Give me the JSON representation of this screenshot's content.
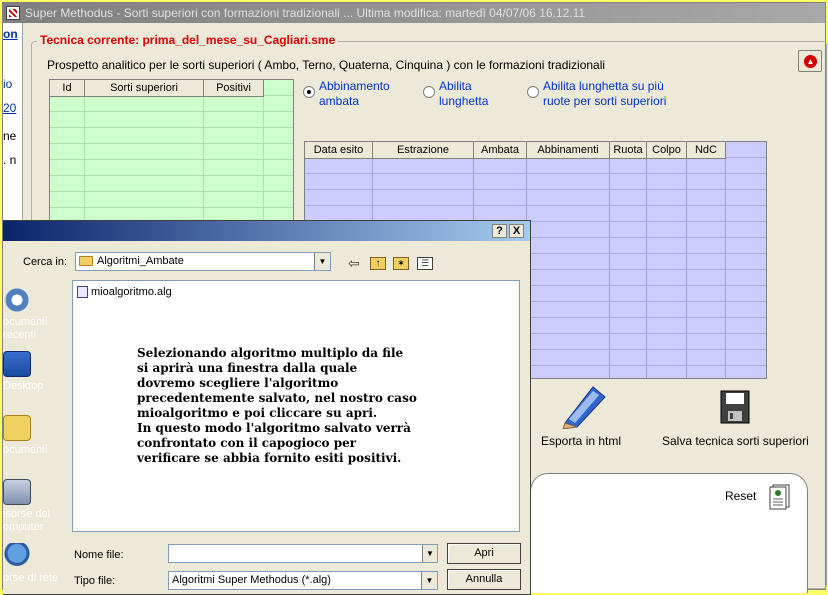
{
  "window": {
    "title": "Super Methodus - Sorti superiori con formazioni tradizionali ... Ultima modifica: martedì 04/07/06 16.12.11"
  },
  "left_strip": [
    "on",
    "io",
    "20",
    "ne",
    ". n"
  ],
  "technique": {
    "label": "Tecnica corrente: prima_del_mese_su_Cagliari.sme",
    "subtitle": "Prospetto analitico per le sorti superiori ( Ambo, Terno, Quaterna, Cinquina ) con le formazioni tradizionali"
  },
  "left_grid": {
    "columns": [
      "Id",
      "Sorti superiori",
      "Positivi"
    ]
  },
  "options": [
    {
      "label": "Abbinamento\nambata",
      "checked": true
    },
    {
      "label": "Abilita\nlunghetta",
      "checked": false
    },
    {
      "label": "Abilita lunghetta su più\nruote per sorti superiori",
      "checked": false
    }
  ],
  "results_grid": {
    "columns": [
      "Data esito",
      "Estrazione",
      "Ambata",
      "Abbinamenti",
      "Ruota",
      "Colpo",
      "NdC"
    ]
  },
  "tools": {
    "export_label": "Esporta in html",
    "save_label": "Salva tecnica sorti superiori",
    "reset_label": "Reset"
  },
  "dialog": {
    "help_btn": "?",
    "close_btn": "X",
    "look_in_label": "Cerca in:",
    "look_in_value": "Algoritmi_Ambate",
    "places": [
      "ocumenti\nrecenti",
      "Desktop",
      "ocumenti",
      "isorse del\nomputer",
      "orse di rete"
    ],
    "files": [
      "mioalgoritmo.alg"
    ],
    "instruction": "Selezionando algoritmo multiplo da file\nsi aprirà una finestra dalla quale\ndovremo scegliere l'algoritmo\nprecedentemente salvato, nel nostro caso\nmioalgoritmo e poi cliccare su apri.\nIn questo modo l'algoritmo salvato verrà\nconfrontato con il capogioco per\nverificare se abbia fornito esiti positivi.",
    "filename_label": "Nome file:",
    "filename_value": "",
    "filetype_label": "Tipo file:",
    "filetype_value": "Algoritmi Super Methodus (*.alg)",
    "open_btn": "Apri",
    "cancel_btn": "Annulla"
  },
  "colors": {
    "green_grid": "#ccffcc",
    "blue_grid": "#ccccff",
    "accent_red": "#e00000",
    "link_blue": "#0033cc"
  }
}
